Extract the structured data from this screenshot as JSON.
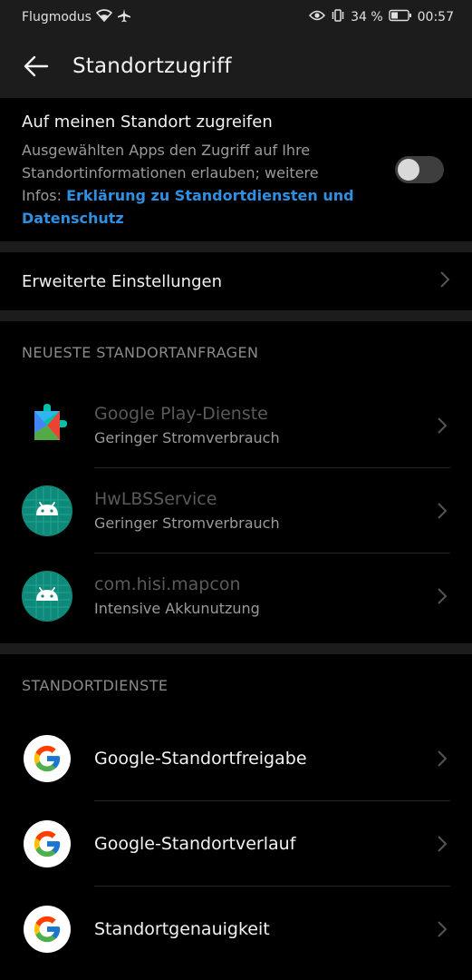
{
  "status_bar": {
    "carrier": "Flugmodus",
    "battery_percent": "34 %",
    "time": "00:57",
    "icons": [
      "wifi-icon",
      "airplane-icon",
      "eye-icon",
      "vibrate-icon",
      "battery-icon"
    ]
  },
  "app_bar": {
    "title": "Standortzugriff",
    "back_icon": "back-arrow-icon"
  },
  "location_access": {
    "title": "Auf meinen Standort zugreifen",
    "description": "Ausgewählten Apps den Zugriff auf Ihre Standortinformationen erlauben; weitere Infos: ",
    "link_text": "Erklärung zu Standortdiensten und Datenschutz",
    "toggle_on": false,
    "link_color": "#2f8fe0"
  },
  "advanced": {
    "label": "Erweiterte Einstellungen"
  },
  "recent_requests": {
    "header": "NEUESTE STANDORTANFRAGEN",
    "items": [
      {
        "name": "Google Play-Dienste",
        "sub": "Geringer Stromverbrauch",
        "icon": "google-play-services-icon"
      },
      {
        "name": "HwLBSService",
        "sub": "Geringer Stromverbrauch",
        "icon": "android-icon"
      },
      {
        "name": "com.hisi.mapcon",
        "sub": "Intensive Akkunutzung",
        "icon": "android-icon"
      }
    ]
  },
  "location_services": {
    "header": "STANDORTDIENSTE",
    "items": [
      {
        "label": "Google-Standortfreigabe",
        "icon": "google-g-icon"
      },
      {
        "label": "Google-Standortverlauf",
        "icon": "google-g-icon"
      },
      {
        "label": "Standortgenauigkeit",
        "icon": "google-g-icon"
      }
    ]
  },
  "colors": {
    "background": "#000000",
    "bar": "#1c1c1c",
    "android_teal": "#0f8a7a"
  }
}
